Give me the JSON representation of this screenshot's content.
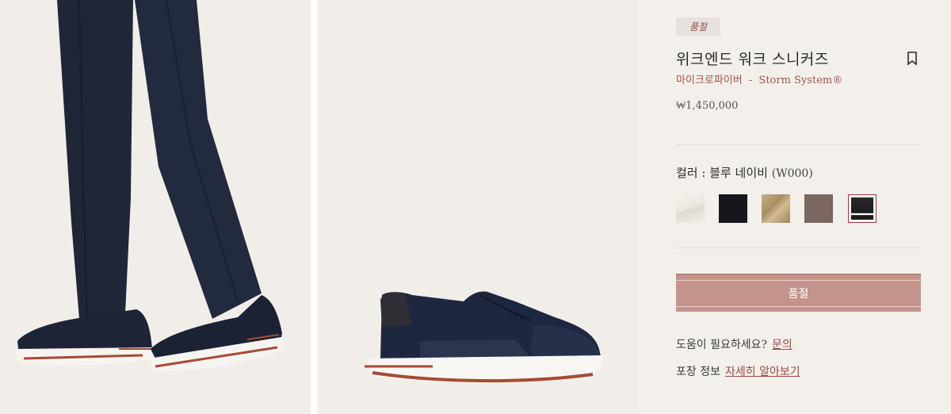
{
  "gallery": {
    "image_1": "model-wearing-sneakers",
    "image_2": "sneaker-side-view"
  },
  "product": {
    "badge": "품절",
    "title": "위크엔드 워크 스니커즈",
    "subtitle_material": "마이크로파이버",
    "subtitle_separator": "-",
    "subtitle_tech": "Storm System®",
    "price": "₩1,450,000"
  },
  "color": {
    "label": "컬러 : 블루 네이비",
    "code": "(W000)",
    "swatches": [
      {
        "name": "off-white",
        "hex": "#ecebe4"
      },
      {
        "name": "black",
        "hex": "#16161c"
      },
      {
        "name": "beige-tan",
        "hex": "#b89c6d"
      },
      {
        "name": "brown-taupe",
        "hex": "#7b6660"
      },
      {
        "name": "blue-navy",
        "hex": "#1d1d26",
        "selected": true
      }
    ]
  },
  "cta": {
    "label": "품절"
  },
  "help": {
    "text": "도움이 필요하세요?",
    "link": "문의"
  },
  "packaging": {
    "text": "포장 정보",
    "link": "자세히 알아보기"
  },
  "colors": {
    "accent": "#9a4b42",
    "cta_bg": "#c4948c",
    "page_bg": "#f3f0ec"
  }
}
